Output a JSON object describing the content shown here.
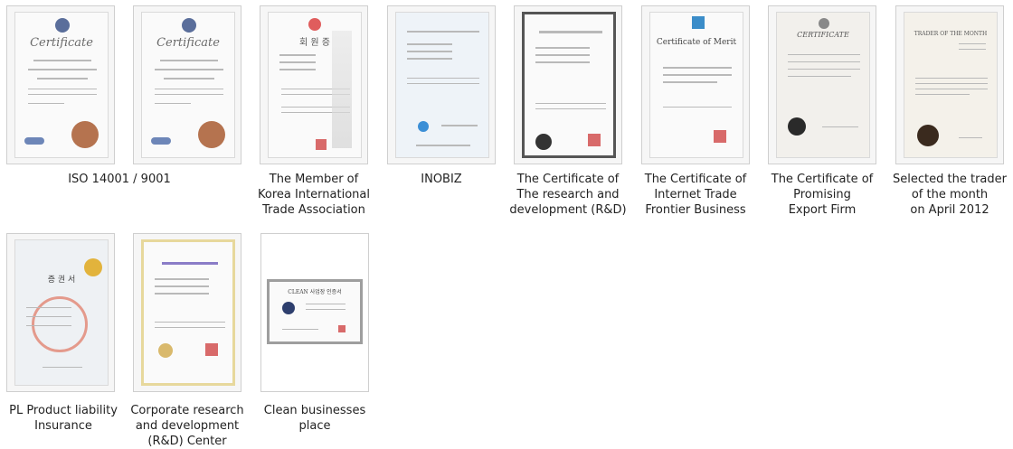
{
  "certificates": [
    {
      "id": "iso-1",
      "doc_title": "Certificate",
      "caption": ""
    },
    {
      "id": "iso-2",
      "doc_title": "Certificate",
      "caption": "ISO 14001 / 9001"
    },
    {
      "id": "kita",
      "doc_title": "회 원 증",
      "caption": "The Member of\nKorea International\nTrade Association"
    },
    {
      "id": "inobiz",
      "doc_title": "",
      "caption": "INOBIZ"
    },
    {
      "id": "rnd-cert",
      "doc_title": "",
      "caption": "The Certificate of\nThe research and\ndevelopment (R&D)"
    },
    {
      "id": "merit",
      "doc_title": "Certificate of Merit",
      "caption": "The Certificate of\nInternet Trade\nFrontier Business"
    },
    {
      "id": "export",
      "doc_title": "CERTIFICATE",
      "caption": "The Certificate of\nPromising\nExport Firm"
    },
    {
      "id": "trader",
      "doc_title": "TRADER OF THE MONTH",
      "caption": "Selected the trader\nof the month\non April 2012"
    },
    {
      "id": "pl",
      "doc_title": "증 권 서",
      "caption": "PL  Product liability\nInsurance"
    },
    {
      "id": "corp-rnd",
      "doc_title": "",
      "caption": "Corporate research\nand development\n(R&D) Center"
    },
    {
      "id": "clean",
      "doc_title": "CLEAN 사업장 인증서",
      "caption": "Clean businesses\nplace"
    }
  ],
  "colors": {
    "card_border": "#cfcfcf",
    "card_bg": "#f6f6f6",
    "caption_text": "#222222",
    "stamp_red": "#d86a6a",
    "seal_bronze": "#b5734f"
  }
}
